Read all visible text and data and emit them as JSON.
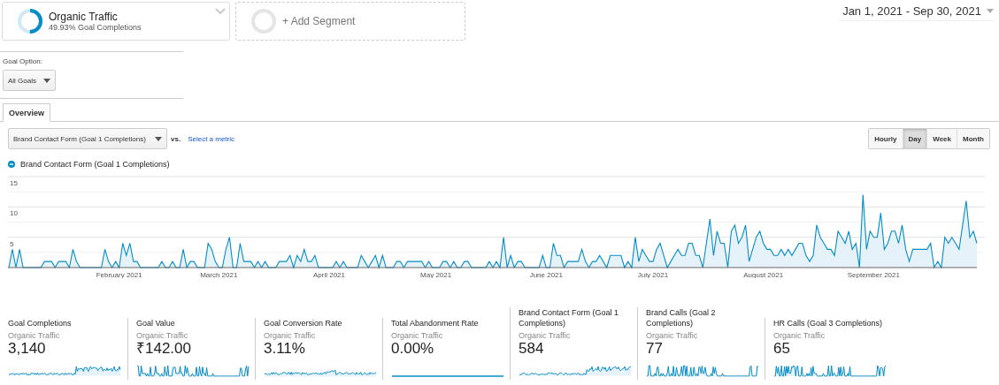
{
  "segments": [
    {
      "kind": "active",
      "title": "Organic Traffic",
      "subtitle": "49.93% Goal Completions"
    },
    {
      "kind": "add",
      "title": "+ Add Segment"
    }
  ],
  "date_range": "Jan 1, 2021 - Sep 30, 2021",
  "goal_option": {
    "label": "Goal Option:",
    "value": "All Goals"
  },
  "tabs": [
    {
      "label": "Overview",
      "selected": true
    }
  ],
  "metric_select": {
    "value": "Brand Contact Form (Goal 1 Completions)",
    "vs": "vs.",
    "link": "Select a metric"
  },
  "granularity": [
    {
      "label": "Hourly",
      "selected": false
    },
    {
      "label": "Day",
      "selected": true
    },
    {
      "label": "Week",
      "selected": false
    },
    {
      "label": "Month",
      "selected": false
    }
  ],
  "chart": {
    "chart_data": {
      "type": "area",
      "categories": [
        null,
        null,
        null,
        null,
        null,
        null,
        null,
        null,
        null,
        null,
        null,
        null,
        null,
        null,
        null,
        null,
        null,
        null,
        null,
        null,
        null,
        null,
        null,
        null,
        null,
        null,
        null,
        null,
        null,
        null,
        null,
        "February 2021",
        null,
        null,
        null,
        null,
        null,
        null,
        null,
        null,
        null,
        null,
        null,
        null,
        null,
        null,
        null,
        null,
        null,
        null,
        null,
        null,
        null,
        null,
        null,
        null,
        null,
        null,
        null,
        "March 2021",
        null,
        null,
        null,
        null,
        null,
        null,
        null,
        null,
        null,
        null,
        null,
        null,
        null,
        null,
        null,
        null,
        null,
        null,
        null,
        null,
        null,
        null,
        null,
        null,
        null,
        null,
        null,
        null,
        null,
        null,
        "April 2021",
        null,
        null,
        null,
        null,
        null,
        null,
        null,
        null,
        null,
        null,
        null,
        null,
        null,
        null,
        null,
        null,
        null,
        null,
        null,
        null,
        null,
        null,
        null,
        null,
        null,
        null,
        null,
        null,
        null,
        "May 2021",
        null,
        null,
        null,
        null,
        null,
        null,
        null,
        null,
        null,
        null,
        null,
        null,
        null,
        null,
        null,
        null,
        null,
        null,
        null,
        null,
        null,
        null,
        null,
        null,
        null,
        null,
        null,
        null,
        null,
        null,
        "June 2021",
        null,
        null,
        null,
        null,
        null,
        null,
        null,
        null,
        null,
        null,
        null,
        null,
        null,
        null,
        null,
        null,
        null,
        null,
        null,
        null,
        null,
        null,
        null,
        null,
        null,
        null,
        null,
        null,
        null,
        "July 2021",
        null,
        null,
        null,
        null,
        null,
        null,
        null,
        null,
        null,
        null,
        null,
        null,
        null,
        null,
        null,
        null,
        null,
        null,
        null,
        null,
        null,
        null,
        null,
        null,
        null,
        null,
        null,
        null,
        null,
        null,
        "August 2021",
        null,
        null,
        null,
        null,
        null,
        null,
        null,
        null,
        null,
        null,
        null,
        null,
        null,
        null,
        null,
        null,
        null,
        null,
        null,
        null,
        null,
        null,
        null,
        null,
        null,
        null,
        null,
        null,
        null,
        null,
        "September 2021",
        null,
        null,
        null,
        null,
        null,
        null,
        null,
        null,
        null,
        null,
        null,
        null,
        null,
        null,
        null,
        null,
        null,
        null,
        null,
        null,
        null,
        null,
        null,
        null,
        null,
        null,
        null,
        null,
        null
      ],
      "ylim": [
        0,
        15
      ],
      "yticks": [
        5,
        10,
        15
      ],
      "series": [
        {
          "name": "Brand Contact Form (Goal 1 Completions)",
          "color": "#058dc7",
          "values": [
            0,
            3,
            0,
            3,
            0,
            0,
            0,
            0,
            0,
            0,
            1,
            1,
            1,
            0,
            1,
            1,
            1,
            0,
            3,
            1,
            0,
            0,
            0,
            0,
            0,
            0,
            0,
            3,
            1,
            0,
            1,
            0,
            4,
            2,
            4,
            1,
            1,
            0,
            0,
            0,
            0,
            0,
            0,
            1,
            0,
            0,
            1,
            0,
            0,
            3,
            0,
            1,
            1,
            0,
            0,
            0,
            4,
            3,
            1,
            0,
            0,
            3,
            5,
            0,
            0,
            4,
            1,
            1,
            1,
            0,
            1,
            0,
            1,
            0,
            0,
            0,
            1,
            1,
            1,
            2,
            0,
            2,
            1,
            3,
            1,
            1,
            2,
            0,
            0,
            0,
            0,
            0,
            1,
            0,
            1,
            0,
            0,
            0,
            0,
            2,
            1,
            0,
            1,
            2,
            0,
            2,
            0,
            0,
            0,
            1,
            1,
            0,
            1,
            1,
            1,
            1,
            1,
            0,
            1,
            0,
            0,
            0,
            1,
            1,
            0,
            1,
            0,
            0,
            1,
            1,
            0,
            0,
            0,
            0,
            0,
            1,
            0,
            1,
            0,
            5,
            0,
            2,
            0,
            1,
            1,
            0,
            0,
            0,
            0,
            0,
            2,
            0,
            0,
            4,
            2,
            2,
            0,
            1,
            1,
            1,
            1,
            3,
            1,
            0,
            1,
            1,
            2,
            1,
            0,
            2,
            2,
            2,
            2,
            0,
            1,
            0,
            5,
            1,
            3,
            2,
            1,
            1,
            3,
            4,
            2,
            0,
            1,
            2,
            3,
            2,
            2,
            4,
            4,
            2,
            2,
            0,
            4,
            8,
            2,
            6,
            4,
            4,
            0,
            6,
            7,
            4,
            5,
            7,
            1,
            3,
            5,
            6,
            4,
            3,
            3,
            2,
            2,
            3,
            2,
            3,
            2,
            3,
            4,
            4,
            2,
            1,
            2,
            7,
            5,
            4,
            3,
            3,
            2,
            6,
            5,
            4,
            6,
            3,
            4,
            0,
            12,
            3,
            6,
            5,
            5,
            9,
            3,
            4,
            6,
            6,
            4,
            7,
            3,
            1,
            3,
            3,
            3,
            3,
            3,
            4,
            0,
            1,
            0,
            5,
            4,
            5,
            4,
            3,
            7,
            11,
            5,
            6,
            4
          ]
        }
      ]
    }
  },
  "metrics": [
    {
      "title": "Goal Completions",
      "segment": "Organic Traffic",
      "value": "3,140",
      "kind": "rising"
    },
    {
      "title": "Goal Value",
      "segment": "Organic Traffic",
      "value": "₹142.00",
      "kind": "spiky"
    },
    {
      "title": "Goal Conversion Rate",
      "segment": "Organic Traffic",
      "value": "3.11%",
      "kind": "noisy"
    },
    {
      "title": "Total Abandonment Rate",
      "segment": "Organic Traffic",
      "value": "0.00%",
      "kind": "flat"
    },
    {
      "title": "Brand Contact Form (Goal 1 Completions)",
      "segment": "Organic Traffic",
      "value": "584",
      "kind": "rising"
    },
    {
      "title": "Brand Calls (Goal 2 Completions)",
      "segment": "Organic Traffic",
      "value": "77",
      "kind": "spiky"
    },
    {
      "title": "HR Calls (Goal 3 Completions)",
      "segment": "Organic Traffic",
      "value": "65",
      "kind": "spiky"
    }
  ]
}
